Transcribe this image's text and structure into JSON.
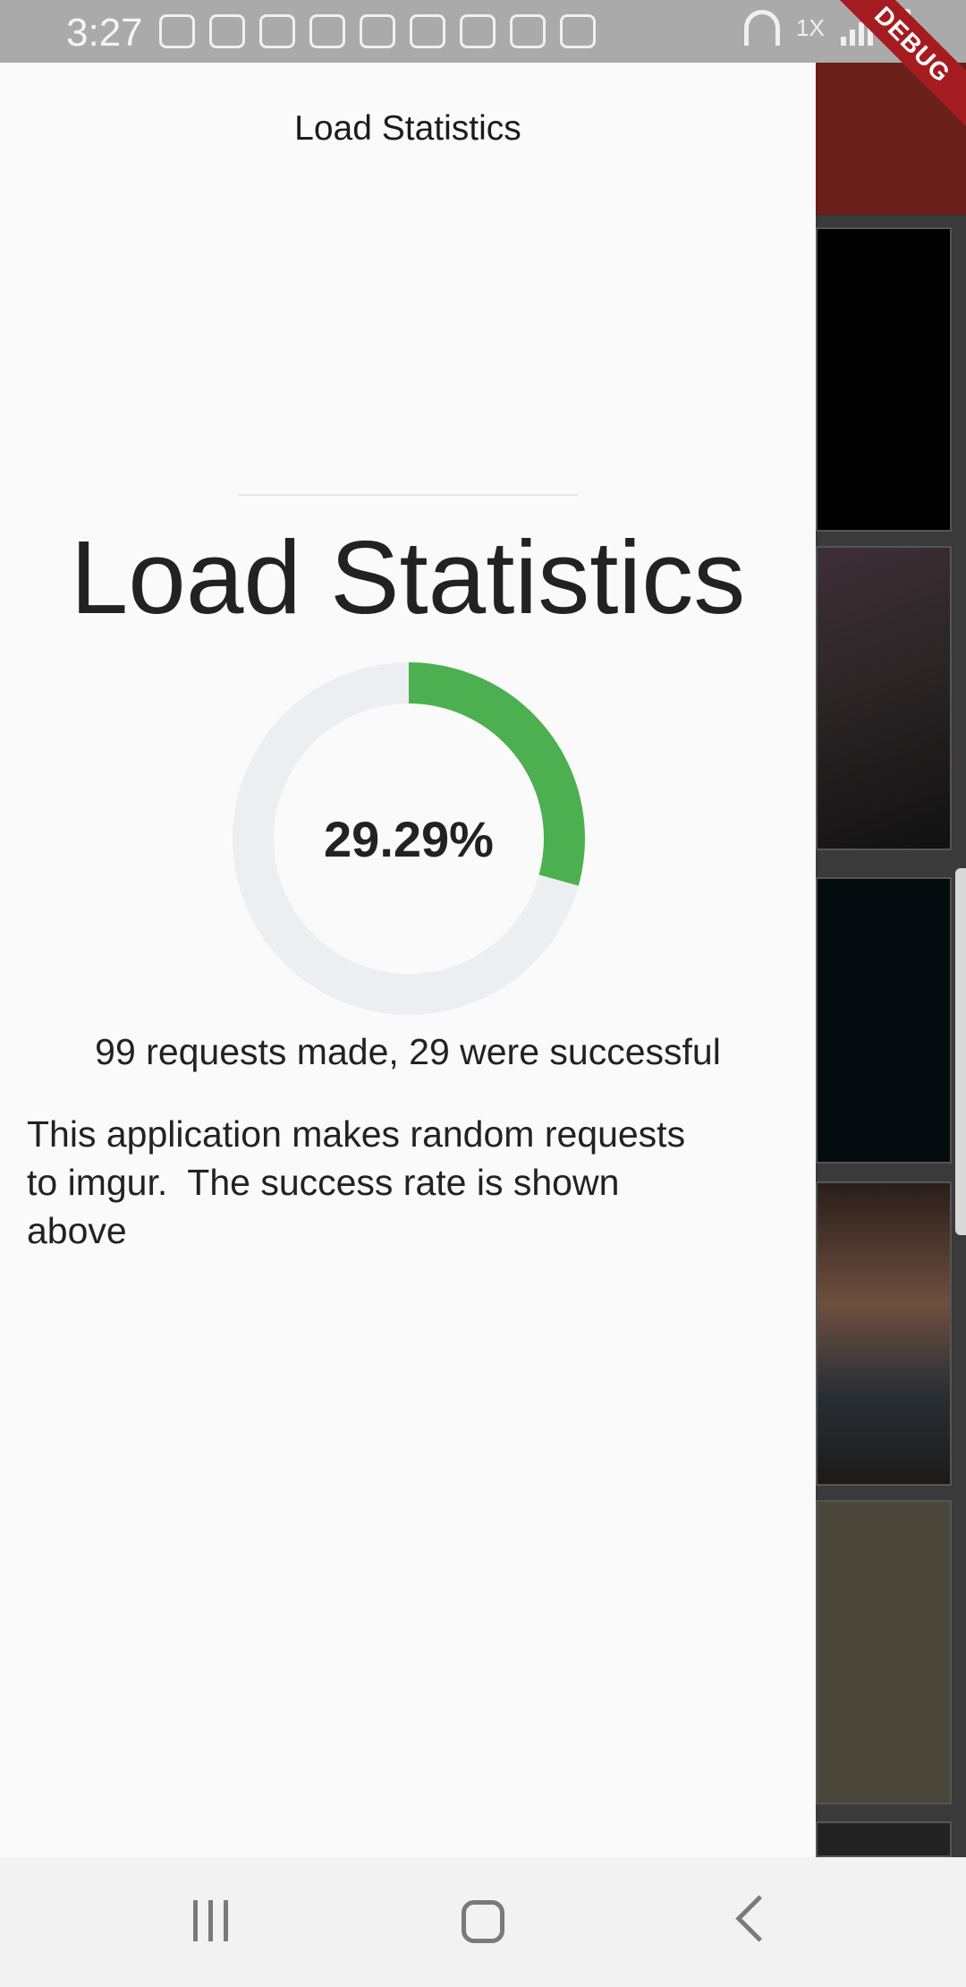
{
  "status_bar": {
    "time": "3:27",
    "notification_icons": [
      "youtube-icon",
      "wifi-call-icon",
      "gmail-icon",
      "news-icon",
      "news-icon",
      "news-icon",
      "sync-icon",
      "unknown-app-icon",
      "battery-saver-icon"
    ],
    "multiplier": "1X",
    "debug_label": "DEBUG"
  },
  "drawer": {
    "header_title": "Load Statistics",
    "stats_title": "Load Statistics",
    "success_percent_label": "29.29%",
    "success_fraction": 0.2929,
    "requests_summary": "99 requests made, 29 were successful",
    "description": "This application makes random requests\nto imgur.  The success rate is shown\nabove"
  },
  "colors": {
    "gauge_progress": "#4caf50",
    "gauge_track": "#eceff1",
    "debug_banner": "#a51c20"
  },
  "nav_bar": {
    "buttons": [
      "recents",
      "home",
      "back"
    ]
  }
}
